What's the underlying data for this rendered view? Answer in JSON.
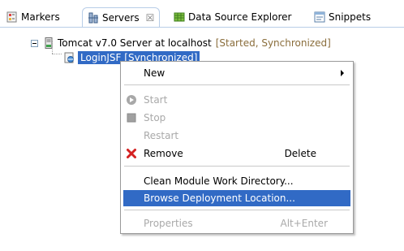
{
  "tabs": [
    {
      "label": "Markers",
      "icon": "markers-icon"
    },
    {
      "label": "Servers",
      "icon": "servers-icon",
      "active": true,
      "close": "☒"
    },
    {
      "label": "Data Source Explorer",
      "icon": "data-source-explorer-icon"
    },
    {
      "label": "Snippets",
      "icon": "snippets-icon"
    }
  ],
  "tree": {
    "server": {
      "name": "Tomcat v7.0 Server at localhost",
      "status": "[Started, Synchronized]"
    },
    "module": {
      "name": "LoginJSF",
      "status": "[Synchronized]"
    }
  },
  "context_menu": {
    "items": [
      {
        "label": "New",
        "submenu": true,
        "enabled": true
      },
      {
        "label": "Start",
        "icon": "start-icon",
        "enabled": false
      },
      {
        "label": "Stop",
        "icon": "stop-icon",
        "enabled": false
      },
      {
        "label": "Restart",
        "enabled": false
      },
      {
        "label": "Remove",
        "icon": "remove-icon",
        "accelerator": "Delete",
        "enabled": true
      },
      {
        "label": "Clean Module Work Directory...",
        "enabled": true
      },
      {
        "label": "Browse Deployment Location...",
        "enabled": true,
        "highlighted": true
      },
      {
        "label": "Properties",
        "accelerator": "Alt+Enter",
        "enabled": false
      }
    ]
  },
  "colors": {
    "selection": "#316ac5",
    "status_text": "#8a6d3b",
    "disabled_text": "#a9a9a9",
    "remove_icon": "#d42020"
  }
}
